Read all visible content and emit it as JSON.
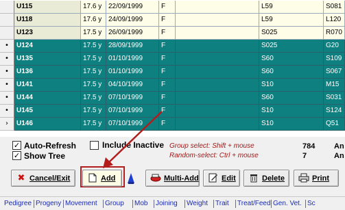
{
  "grid": {
    "rows": [
      {
        "indicator": "",
        "id": "U115",
        "age": "17.6 y",
        "date": "22/09/1999",
        "sex": "F",
        "sire": "L59",
        "extra": "S081",
        "style": "light"
      },
      {
        "indicator": "",
        "id": "U118",
        "age": "17.6 y",
        "date": "24/09/1999",
        "sex": "F",
        "sire": "L59",
        "extra": "L120",
        "style": "light"
      },
      {
        "indicator": "",
        "id": "U123",
        "age": "17.5 y",
        "date": "26/09/1999",
        "sex": "F",
        "sire": "S025",
        "extra": "R070",
        "style": "light"
      },
      {
        "indicator": "•",
        "id": "U124",
        "age": "17.5 y",
        "date": "28/09/1999",
        "sex": "F",
        "sire": "S025",
        "extra": "G20",
        "style": "dark"
      },
      {
        "indicator": "•",
        "id": "U135",
        "age": "17.5 y",
        "date": "01/10/1999",
        "sex": "F",
        "sire": "S60",
        "extra": "S109",
        "style": "dark"
      },
      {
        "indicator": "•",
        "id": "U136",
        "age": "17.5 y",
        "date": "01/10/1999",
        "sex": "F",
        "sire": "S60",
        "extra": "S067",
        "style": "dark"
      },
      {
        "indicator": "•",
        "id": "U141",
        "age": "17.5 y",
        "date": "04/10/1999",
        "sex": "F",
        "sire": "S10",
        "extra": "M15",
        "style": "dark"
      },
      {
        "indicator": "•",
        "id": "U144",
        "age": "17.5 y",
        "date": "07/10/1999",
        "sex": "F",
        "sire": "S60",
        "extra": "S031",
        "style": "dark"
      },
      {
        "indicator": "•",
        "id": "U145",
        "age": "17.5 y",
        "date": "07/10/1999",
        "sex": "F",
        "sire": "S10",
        "extra": "S124",
        "style": "dark"
      },
      {
        "indicator": "›",
        "id": "U146",
        "age": "17.5 y",
        "date": "07/10/1999",
        "sex": "F",
        "sire": "S10",
        "extra": "Q51",
        "style": "dark"
      }
    ]
  },
  "options": {
    "auto_refresh": {
      "label": "Auto-Refresh",
      "checked": true
    },
    "show_tree": {
      "label": "Show Tree",
      "checked": true
    },
    "include_inactive": {
      "label": "Include Inactive",
      "checked": false
    }
  },
  "hints": {
    "group_select": "Group select: Shift + mouse",
    "random_select": "Random-select: Ctrl + mouse"
  },
  "counts": {
    "total": "784",
    "total_label": "An",
    "selected": "7",
    "selected_label": "An"
  },
  "toolbar": {
    "cancel_exit": "Cancel/Exit",
    "add": "Add",
    "multi_add": "Multi-Add",
    "edit": "Edit",
    "delete": "Delete",
    "print": "Print"
  },
  "tabs": [
    "Pedigree",
    "Progeny",
    "Movement",
    "Group",
    "Mob",
    "Joining",
    "Weight",
    "Trait",
    "Treat/Feed",
    "Gen. Vet.",
    "Sc"
  ],
  "colors": {
    "selected_row": "#0f8080",
    "unselected_row": "#fefee8",
    "hint_text": "#a01818",
    "tab_link": "#1a2bb0",
    "highlight_frame": "#b21c1c"
  },
  "icons": {
    "cancel": "red-x-icon",
    "add": "new-document-icon",
    "multi_add": "multi-add-icon",
    "edit": "edit-icon",
    "delete": "trash-icon",
    "print": "printer-icon"
  }
}
